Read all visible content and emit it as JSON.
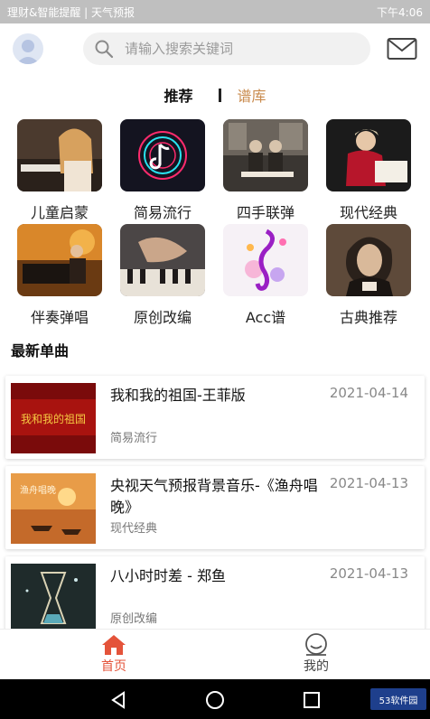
{
  "status_bar": {
    "left_text": "理财&智能提醒 | 天气预报",
    "time": "下午4:06"
  },
  "header": {
    "search_placeholder": "请输入搜索关键词"
  },
  "tabs": [
    {
      "label": "推荐",
      "active": true
    },
    {
      "label": "谱库",
      "active": false
    }
  ],
  "categories": [
    {
      "label": "儿童启蒙"
    },
    {
      "label": "简易流行"
    },
    {
      "label": "四手联弹"
    },
    {
      "label": "现代经典"
    },
    {
      "label": "伴奏弹唱"
    },
    {
      "label": "原创改编"
    },
    {
      "label": "Acc谱"
    },
    {
      "label": "古典推荐"
    }
  ],
  "section": {
    "title": "最新单曲"
  },
  "songs": [
    {
      "title": "我和我的祖国-王菲版",
      "date": "2021-04-14",
      "category": "简易流行",
      "cover_text": "我和我的祖国"
    },
    {
      "title": "央视天气预报背景音乐-《渔舟唱晚》",
      "date": "2021-04-13",
      "category": "现代经典",
      "cover_text": "渔舟唱晚"
    },
    {
      "title": "八小时时差 - 郑鱼",
      "date": "2021-04-13",
      "category": "原创改编",
      "cover_text": ""
    }
  ],
  "bottom_nav": [
    {
      "label": "首页",
      "active": true
    },
    {
      "label": "我的",
      "active": false
    }
  ],
  "watermark": "53软件园",
  "colors": {
    "accent": "#e4533a",
    "tab_inactive": "#c98b4e",
    "status_bar": "#bfbfbf"
  }
}
